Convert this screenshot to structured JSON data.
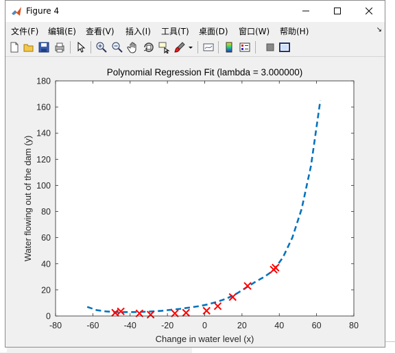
{
  "window": {
    "title": "Figure 4"
  },
  "menu": [
    "文件(F)",
    "编辑(E)",
    "查看(V)",
    "插入(I)",
    "工具(T)",
    "桌面(D)",
    "窗口(W)",
    "帮助(H)"
  ],
  "toolbar_icons": [
    "new-figure-icon",
    "open-file-icon",
    "save-icon",
    "print-icon",
    "pointer-icon",
    "zoom-in-icon",
    "zoom-out-icon",
    "pan-icon",
    "rotate-3d-icon",
    "data-cursor-icon",
    "brush-icon",
    "brush-dropdown-icon",
    "link-plot-icon",
    "insert-colorbar-icon",
    "insert-legend-icon",
    "hide-plot-tools-icon",
    "show-plot-tools-icon"
  ],
  "chart_data": {
    "type": "scatter",
    "title": "Polynomial Regression Fit (lambda = 3.000000)",
    "xlabel": "Change in water level (x)",
    "ylabel": "Water flowing out of the dam (y)",
    "xlim": [
      -80,
      80
    ],
    "ylim": [
      0,
      180
    ],
    "xticks": [
      -80,
      -60,
      -40,
      -20,
      0,
      20,
      40,
      60,
      80
    ],
    "yticks": [
      0,
      20,
      40,
      60,
      80,
      100,
      120,
      140,
      160,
      180
    ],
    "grid": false,
    "series": [
      {
        "type": "scatter",
        "marker": "x",
        "color": "#ff0000",
        "x": [
          -48,
          -45,
          -35,
          -29,
          -16,
          -10,
          1,
          7,
          15,
          23,
          37,
          38
        ],
        "y": [
          2.5,
          3.5,
          2.0,
          1.0,
          2.0,
          2.5,
          4.0,
          7.5,
          14.5,
          23.0,
          35.5,
          37.0
        ]
      },
      {
        "type": "line",
        "style": "dashed",
        "color": "#0072bd",
        "x": [
          -63,
          -58,
          -53,
          -48,
          -43,
          -38,
          -33,
          -28,
          -23,
          -18,
          -13,
          -8,
          -3,
          2,
          7,
          12,
          17,
          22,
          27,
          32,
          37,
          42,
          47,
          52,
          57,
          62
        ],
        "y": [
          7,
          4.5,
          3.5,
          3,
          3,
          3,
          3.2,
          3.5,
          4,
          4.8,
          5.5,
          6.5,
          7.5,
          9,
          11,
          13.5,
          17,
          21.5,
          26,
          30,
          35,
          45,
          60,
          82,
          115,
          165
        ]
      }
    ]
  }
}
